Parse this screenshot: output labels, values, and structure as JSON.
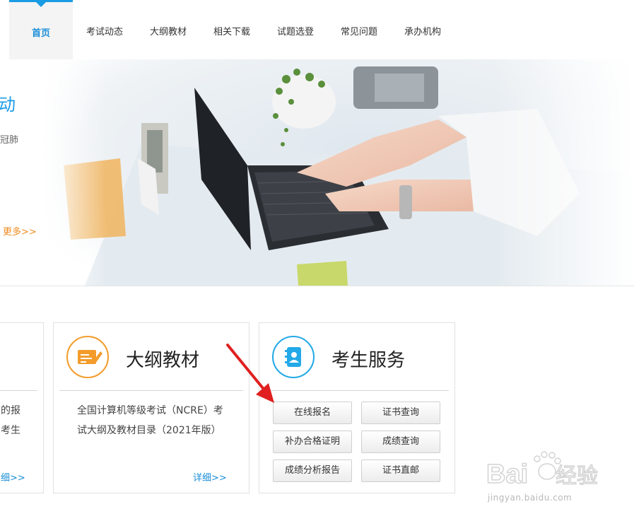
{
  "nav": {
    "items": [
      {
        "label": "首页"
      },
      {
        "label": "考试动态"
      },
      {
        "label": "大纲教材"
      },
      {
        "label": "相关下载"
      },
      {
        "label": "试题选登"
      },
      {
        "label": "常见问题"
      },
      {
        "label": "承办机构"
      }
    ],
    "active_index": 0,
    "accent": "#1a9be6"
  },
  "banner": {
    "title_fragment": "动",
    "text_fragment": "冠肺",
    "more_label": "更多>>"
  },
  "cards": {
    "left_partial": {
      "text_lines": [
        "的报",
        "考生"
      ],
      "link_label": "细>>"
    },
    "syllabus": {
      "icon": "syllabus-book-icon",
      "title": "大纲教材",
      "text_lines": [
        "全国计算机等级考试（NCRE）考",
        "试大纲及教材目录（2021年版）"
      ],
      "link_label": "详细>>",
      "icon_color": "#f39c2b"
    },
    "services": {
      "icon": "address-book-icon",
      "title": "考生服务",
      "icon_color": "#23a9e8",
      "buttons": [
        {
          "label": "在线报名"
        },
        {
          "label": "证书查询"
        },
        {
          "label": "补办合格证明"
        },
        {
          "label": "成绩查询"
        },
        {
          "label": "成绩分析报告"
        },
        {
          "label": "证书直邮"
        }
      ]
    }
  },
  "annotation": {
    "arrow_color": "#e02020"
  },
  "watermark": {
    "logo_text": "Baidu经验",
    "url": "jingyan.baidu.com"
  }
}
